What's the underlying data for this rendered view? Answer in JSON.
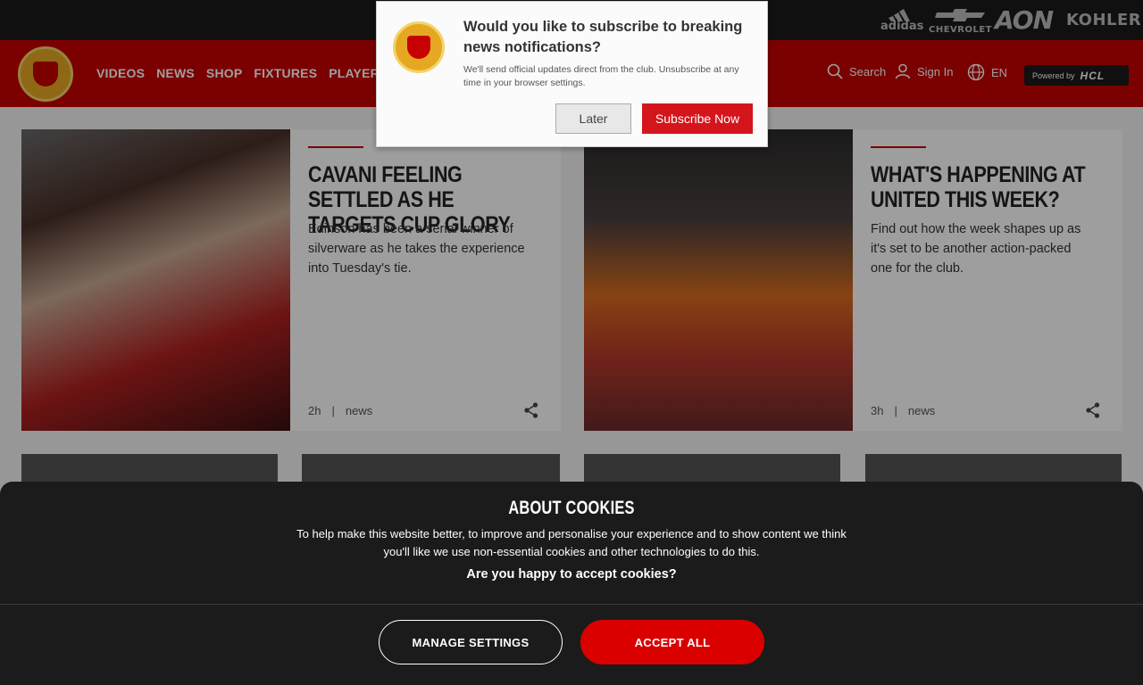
{
  "sponsors": {
    "adidas": "adidas",
    "chevrolet": "CHEVROLET",
    "aon": "AON",
    "kohler": "KOHLER"
  },
  "nav": {
    "items": [
      "VIDEOS",
      "NEWS",
      "SHOP",
      "FIXTURES",
      "PLAYER"
    ],
    "search_label": "Search",
    "signin_label": "Sign In",
    "language": "EN",
    "powered_by": "Powered by",
    "powered_brand": "HCL"
  },
  "cards": [
    {
      "title": "Cavani feeling settled as he targets cup glory",
      "description": "Edinson has been a serial winner of silverware as he takes the experience into Tuesday's tie.",
      "time": "2h",
      "separator": "|",
      "category": "news"
    },
    {
      "title": "What's happening at United this week?",
      "description": "Find out how the week shapes up as it's set to be another action-packed one for the club.",
      "time": "3h",
      "separator": "|",
      "category": "news"
    }
  ],
  "popup": {
    "title": "Would you like to subscribe to breaking news notifications?",
    "text": "We'll send official updates direct from the club. Unsubscribe at any time in your browser settings.",
    "later_label": "Later",
    "subscribe_label": "Subscribe Now"
  },
  "cookie": {
    "title": "ABOUT COOKIES",
    "text": "To help make this website better, to improve and personalise your experience and to show content we think you'll like we use non-essential cookies and other technologies to do this.",
    "question": "Are you happy to accept cookies?",
    "manage_label": "MANAGE SETTINGS",
    "accept_label": "ACCEPT ALL"
  },
  "colors": {
    "brand_red": "#c70101",
    "accept_red": "#da0000",
    "dark": "#1b1b1b"
  }
}
